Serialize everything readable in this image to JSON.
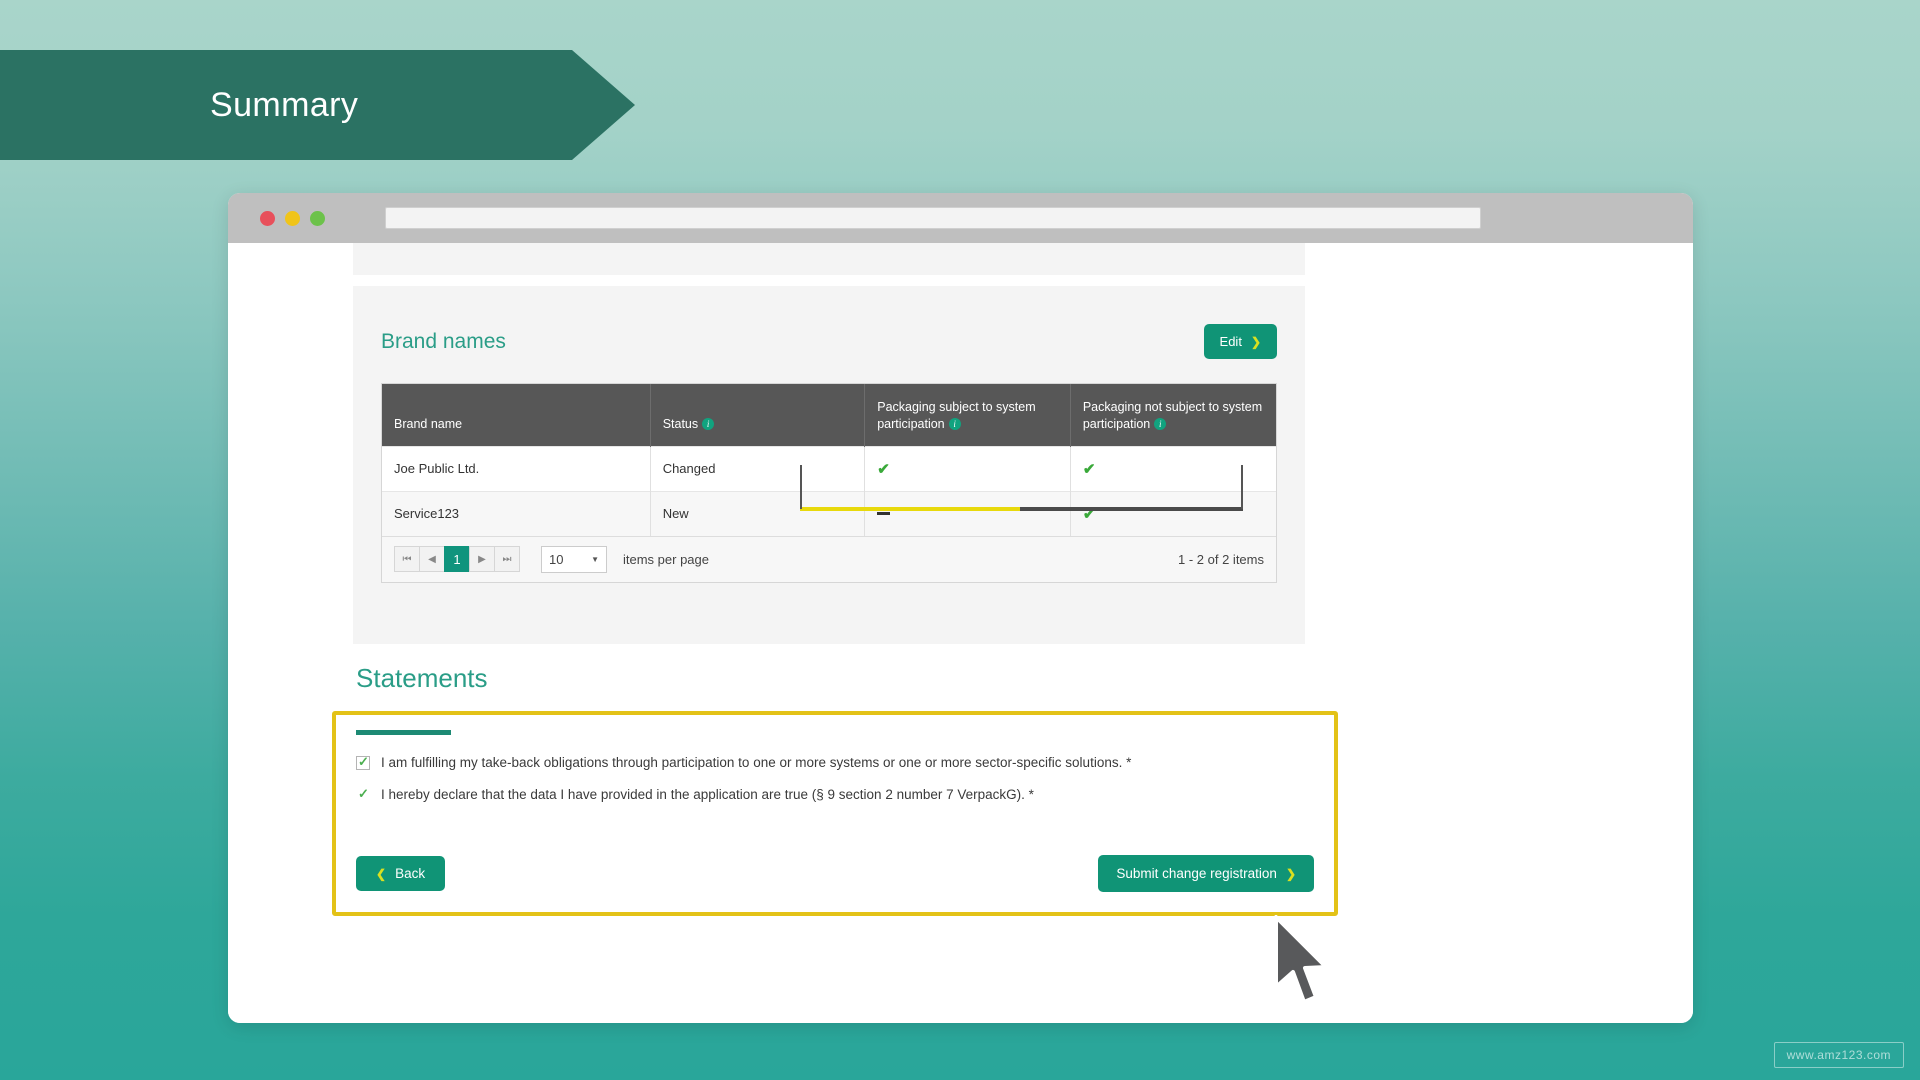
{
  "banner": {
    "title": "Summary"
  },
  "browser": {
    "traffic_lights": [
      "close-red",
      "minimize-yellow",
      "maximize-green"
    ],
    "address_value": "",
    "address_placeholder": ""
  },
  "brand_panel": {
    "title": "Brand names",
    "edit_button": "Edit",
    "edit_chevron": "chevron-right-icon",
    "table": {
      "columns": [
        {
          "label": "Brand name",
          "has_info_icon": false
        },
        {
          "label": "Status",
          "has_info_icon": true
        },
        {
          "label": "Packaging subject to system participation",
          "has_info_icon": true
        },
        {
          "label": "Packaging not subject to system participation",
          "has_info_icon": true
        }
      ],
      "rows": [
        {
          "brand_name": "Joe Public Ltd.",
          "status": "Changed",
          "subject": "check",
          "not_subject": "check"
        },
        {
          "brand_name": "Service123",
          "status": "New",
          "subject": "dash",
          "not_subject": "check"
        }
      ]
    },
    "pager": {
      "first": "⏮",
      "prev": "◀",
      "page": "1",
      "next": "▶",
      "last": "⏭",
      "page_size": "10",
      "page_size_label": "items per page",
      "range_label": "1 - 2 of 2 items"
    }
  },
  "statements": {
    "title": "Statements",
    "items": [
      {
        "checked": true,
        "text": "I am fulfilling my take-back obligations through participation to one or more systems or one or more sector-specific solutions. *"
      },
      {
        "checked": true,
        "text": "I hereby declare that the data I have provided in the application are true (§ 9 section 2 number 7 VerpackG). *"
      }
    ],
    "back_button": "Back",
    "back_chevron": "chevron-left-icon",
    "submit_button": "Submit change registration",
    "submit_chevron": "chevron-right-icon"
  },
  "watermark": "www.amz123.com",
  "colors": {
    "banner_bg": "#2b7263",
    "brand_teal": "#2a9d87",
    "button_green": "#109476",
    "chevron_yellow": "#d9e021",
    "table_header": "#575757",
    "check_green": "#3aa93a",
    "annotation_yellow": "#e3c217",
    "annotation_dark": "#4a4a4a",
    "page_bg_top": "#a9d5ca",
    "page_bg_bottom": "#29a69a"
  }
}
